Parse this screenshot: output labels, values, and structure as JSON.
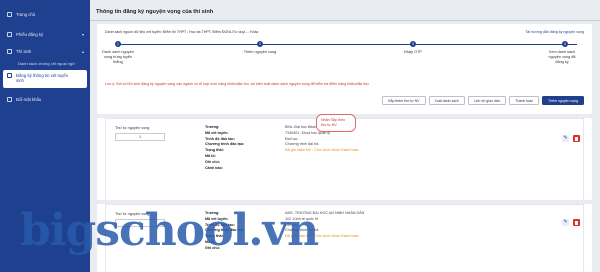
{
  "sidebar": {
    "items": [
      {
        "label": "Trang chủ"
      },
      {
        "label": "Phiếu đăng ký"
      },
      {
        "label": "Thí sinh"
      }
    ],
    "subitems": [
      {
        "label": "Danh sách chứng chỉ ngoại ngữ"
      }
    ],
    "active": {
      "line1": "Đăng ký thông tin xét tuyển",
      "line2": "sinh"
    },
    "last": {
      "label": "Đổi mật khẩu"
    }
  },
  "page": {
    "title": "Thông tin đăng ký nguyện vọng của thí sinh"
  },
  "source": {
    "text": "Danh sách nguồn dữ liệu xét tuyển: Điểm thi THPT ; Học bạ THPT; Điểm ĐGNL/Tư duy/...; Khác",
    "guide": "Tài hướng dẫn đăng ký nguyện vọng"
  },
  "steps": [
    {
      "num": "1",
      "label1": "Danh sách nguyện",
      "label2": "vọng trúng tuyển",
      "label3": "thẳng"
    },
    {
      "num": "2",
      "label1": "Thêm nguyện vọng",
      "label2": "",
      "label3": ""
    },
    {
      "num": "3",
      "label1": "Nhập OTP",
      "label2": "",
      "label3": ""
    },
    {
      "num": "4",
      "label1": "Xem danh sách",
      "label2": "nguyện vọng đã",
      "label3": "đăng ký"
    }
  ],
  "note": "Lưu ý: Đối với thí sinh đăng ký nguyện vọng vào ngành có tổ hợp môn năng khiếu/đặc thù, dự kiến xuất danh sách nguyện vọng để kiểm tra điểm năng khiếu/đặc thù.",
  "buttons": {
    "sort": "Sắp thêm thứ tự NV",
    "export": "Xuất danh sách",
    "history": "Lịch sử giao dịch",
    "pay": "Thanh toán",
    "add": "Thêm nguyện vọng"
  },
  "tooltip": {
    "line1": "Nhấn Sắp theo",
    "line2": "thứ tự NV"
  },
  "fields": {
    "school": "Trường:",
    "code": "Mã xét tuyển:",
    "level": "Trình độ đào tạo:",
    "program": "Chương trình đào tạo:",
    "status": "Trạng thái:",
    "combo": "Mã tổ:",
    "note": "Ghi chú:",
    "warning": "Cảnh báo:"
  },
  "records": [
    {
      "priority_label": "Thứ tự nguyện vọng",
      "priority": "1",
      "school": "BKA -Đại học Bách Khoa Hà Nội",
      "code": "7340401 -Khoa học quản lý",
      "level": "Đại học",
      "program": "Chương trình đại trà",
      "status": "Đã ghi nhận NV - Chờ chọn được thanh toán",
      "combo": "",
      "note": "",
      "warning": ""
    },
    {
      "priority_label": "Thứ tự nguyện vọng",
      "priority": "2",
      "school": "ANS -TRƯỜNG ĐẠI HỌC AN NINH NHÂN DÂN",
      "code": "102 -Kinh tế quốc tế",
      "level": "Đại học",
      "program": "Chương trình đại trà",
      "status": "Đã ghi nhận NV - Chờ chọn được thanh toán",
      "combo": "",
      "note": "",
      "warning": ""
    }
  ],
  "watermark": "bigschool.vn",
  "colors": {
    "primary": "#1f3f8f",
    "danger": "#d9322b",
    "warning_text": "#c0392b",
    "status": "#e08a1e"
  }
}
